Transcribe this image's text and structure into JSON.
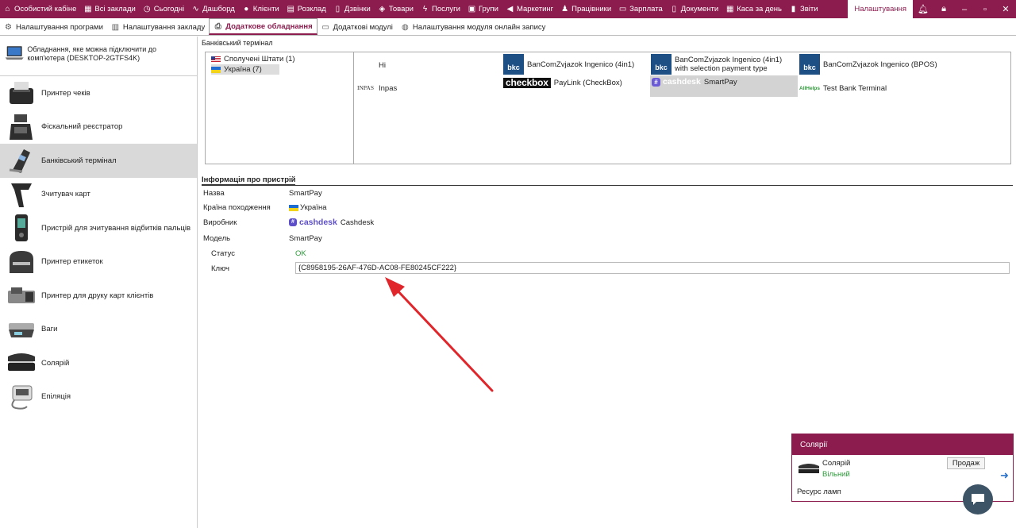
{
  "topnav": {
    "items": [
      {
        "label": "Особистий кабіне",
        "icon": "home-icon"
      },
      {
        "label": "Всі заклади",
        "icon": "grid-icon"
      },
      {
        "label": "Сьогодні",
        "icon": "clock-icon"
      },
      {
        "label": "Дашборд",
        "icon": "pulse-icon"
      },
      {
        "label": "Клієнти",
        "icon": "user-circle-icon"
      },
      {
        "label": "Розклад",
        "icon": "calendar-icon"
      },
      {
        "label": "Дзвінки",
        "icon": "phone-icon"
      },
      {
        "label": "Товари",
        "icon": "box-icon"
      },
      {
        "label": "Послуги",
        "icon": "bolt-icon"
      },
      {
        "label": "Групи",
        "icon": "groups-icon"
      },
      {
        "label": "Маркетинг",
        "icon": "megaphone-icon"
      },
      {
        "label": "Працівники",
        "icon": "person-icon"
      },
      {
        "label": "Зарплата",
        "icon": "money-icon"
      },
      {
        "label": "Документи",
        "icon": "document-icon"
      },
      {
        "label": "Каса за день",
        "icon": "calculator-icon"
      },
      {
        "label": "Звіти",
        "icon": "bar-chart-icon"
      }
    ],
    "active": "Налаштування"
  },
  "subtabs": [
    {
      "label": "Налаштування програми",
      "icon": "gear-icon",
      "active": false
    },
    {
      "label": "Налаштування закладу",
      "icon": "building-icon",
      "active": false
    },
    {
      "label": "Додаткове обладнання",
      "icon": "printer-icon",
      "active": true
    },
    {
      "label": "Додаткові модулі",
      "icon": "module-icon",
      "active": false
    },
    {
      "label": "Налаштування модуля онлайн запису",
      "icon": "globe-icon",
      "active": false
    }
  ],
  "sidebar": {
    "header": "Обладнання, яке можна підключити до комп'ютера (DESKTOP-2GTFS4K)",
    "items": [
      {
        "label": "Принтер чеків",
        "icon": "receipt-printer-icon"
      },
      {
        "label": "Фіскальний реєстратор",
        "icon": "fiscal-register-icon"
      },
      {
        "label": "Банківський термінал",
        "icon": "card-terminal-icon"
      },
      {
        "label": "Зчитувач карт",
        "icon": "card-reader-icon"
      },
      {
        "label": "Пристрій для зчитування відбитків пальців",
        "icon": "fingerprint-reader-icon"
      },
      {
        "label": "Принтер етикеток",
        "icon": "label-printer-icon"
      },
      {
        "label": "Принтер для друку карт клієнтів",
        "icon": "card-printer-icon"
      },
      {
        "label": "Ваги",
        "icon": "scales-icon"
      },
      {
        "label": "Солярій",
        "icon": "solarium-icon"
      },
      {
        "label": "Епіляція",
        "icon": "epilation-icon"
      }
    ],
    "active_index": 2
  },
  "main": {
    "section_title": "Банківський термінал",
    "countries": [
      {
        "label": "Сполучені Штати (1)",
        "flag": "us",
        "active": false
      },
      {
        "label": "Україна (7)",
        "flag": "ua",
        "active": true
      }
    ],
    "terminals": [
      {
        "label": "Hi",
        "logo": ""
      },
      {
        "label": "BanComZvjazok Ingenico (4in1)",
        "logo": "bkc"
      },
      {
        "label": "BanComZvjazok Ingenico (4in1) with selection payment type",
        "logo": "bkc"
      },
      {
        "label": "BanComZvjazok Ingenico (BPOS)",
        "logo": "bkc"
      },
      {
        "label": "Inpas",
        "logo": "inpas"
      },
      {
        "label": "PayLink (CheckBox)",
        "logo": "checkbox"
      },
      {
        "label": "SmartPay",
        "logo": "cashdesk",
        "selected": true
      },
      {
        "label": "Test Bank Terminal",
        "logo": "allhelps"
      }
    ],
    "logo_texts": {
      "bkc": "bkc",
      "checkbox": "checkbox",
      "cashdesk": "cashdesk",
      "inpas": "INPAS",
      "allhelps": "AllHelps"
    },
    "info": {
      "title": "Інформація про пристрій",
      "name_label": "Назва",
      "name_value": "SmartPay",
      "country_label": "Країна походження",
      "country_value": "Україна",
      "maker_label": "Виробник",
      "maker_logo": "cashdesk",
      "maker_value": "Cashdesk",
      "model_label": "Модель",
      "model_value": "SmartPay",
      "status_label": "Статус",
      "status_value": "OK",
      "key_label": "Ключ",
      "key_value": "{C8958195-26AF-476D-AC08-FE80245CF222}"
    }
  },
  "popup": {
    "title": "Солярії",
    "device_name": "Солярій",
    "device_status": "Вільний",
    "sell_label": "Продаж",
    "lamp_resource_label": "Ресурс ламп"
  },
  "colors": {
    "brand": "#8c1c4e",
    "ok": "#2e9b3b",
    "annotation_arrow": "#e0262b"
  }
}
